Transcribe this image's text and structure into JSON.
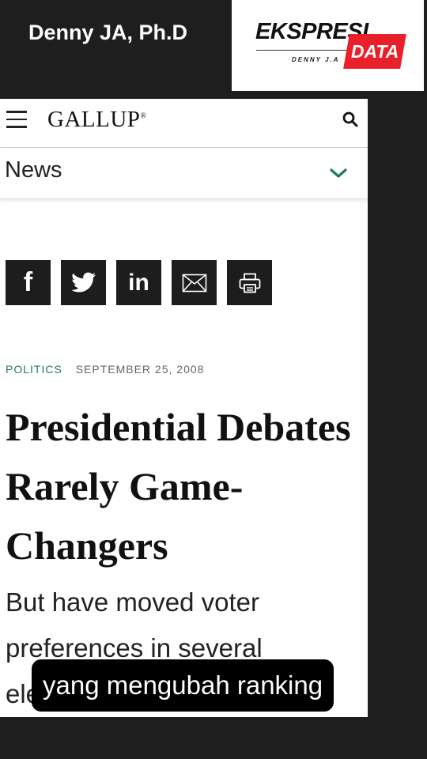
{
  "overlay": {
    "author": "Denny JA, Ph.D",
    "logo": {
      "main": "EKSPRESI",
      "badge": "DATA",
      "sub": "DENNY J.A",
      "badge_color": "#e8202a"
    },
    "caption": "yang mengubah ranking"
  },
  "header": {
    "menu_icon": "hamburger-menu-icon",
    "brand": "GALLUP",
    "brand_mark": "®",
    "search_icon": "search-icon"
  },
  "nav": {
    "label": "News",
    "chevron_icon": "chevron-down-icon",
    "accent": "#227a60"
  },
  "share": [
    {
      "icon": "facebook-icon",
      "glyph": "f"
    },
    {
      "icon": "twitter-icon",
      "glyph": ""
    },
    {
      "icon": "linkedin-icon",
      "glyph": "in"
    },
    {
      "icon": "email-icon",
      "glyph": ""
    },
    {
      "icon": "print-icon",
      "glyph": ""
    }
  ],
  "article": {
    "category": "POLITICS",
    "date": "SEPTEMBER 25, 2008",
    "title": "Presidential Debates Rarely Game-Changers",
    "dek": "But have moved voter preferences in several elections"
  }
}
